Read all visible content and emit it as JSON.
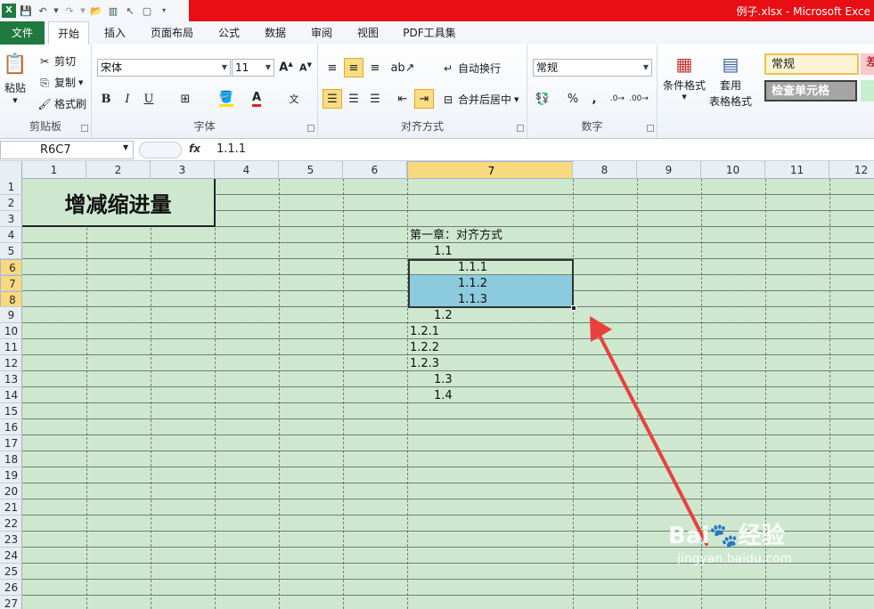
{
  "window": {
    "title": "例子.xlsx - Microsoft Exce"
  },
  "tabs": [
    "文件",
    "开始",
    "插入",
    "页面布局",
    "公式",
    "数据",
    "审阅",
    "视图",
    "PDF工具集"
  ],
  "active_tab": "开始",
  "ribbon": {
    "clipboard": {
      "paste": "粘贴",
      "cut": "剪切",
      "copy": "复制",
      "format_painter": "格式刷",
      "label": "剪贴板"
    },
    "font": {
      "name": "宋体",
      "size": "11",
      "label": "字体",
      "bold": "B",
      "italic": "I",
      "underline": "U"
    },
    "alignment": {
      "wrap": "自动换行",
      "merge": "合并后居中",
      "label": "对齐方式"
    },
    "number": {
      "format": "常规",
      "label": "数字",
      "percent": "%",
      "comma": ","
    },
    "styles": {
      "conditional": "条件格式",
      "table_format_line1": "套用",
      "table_format_line2": "表格格式",
      "style_normal": "常规",
      "style_check": "检查单元格",
      "style_bad": "差"
    }
  },
  "formula_bar": {
    "name_box": "R6C7",
    "fx": "fx",
    "value": "1.1.1"
  },
  "columns": [
    "1",
    "2",
    "3",
    "4",
    "5",
    "6",
    "7",
    "8",
    "9",
    "10",
    "11",
    "12"
  ],
  "selected_column": "7",
  "rows": [
    "1",
    "2",
    "3",
    "4",
    "5",
    "6",
    "7",
    "8",
    "9",
    "10",
    "11",
    "12",
    "13",
    "14",
    "15",
    "16",
    "17",
    "18",
    "19",
    "20",
    "21",
    "22",
    "23",
    "24",
    "25",
    "26",
    "27"
  ],
  "selected_rows": [
    "6",
    "7",
    "8"
  ],
  "cells": {
    "title": "增减缩进量",
    "r4": "第一章：对齐方式",
    "r5": "1.1",
    "r6": "1.1.1",
    "r7": "1.1.2",
    "r8": "1.1.3",
    "r9": "1.2",
    "r10": "1.2.1",
    "r11": "1.2.2",
    "r12": "1.2.3",
    "r13": "1.3",
    "r14": "1.4"
  },
  "watermark": {
    "brand": "Bai",
    "brand2": "经验",
    "url": "jingyan.baidu.com"
  },
  "colors": {
    "sheet_bg": "#cde8cf",
    "selection_fill": "#8ccbde",
    "header_highlight": "#f9d97f",
    "title_bar": "#e70f13",
    "file_tab": "#1f7a3f",
    "arrow": "#e8413c"
  }
}
